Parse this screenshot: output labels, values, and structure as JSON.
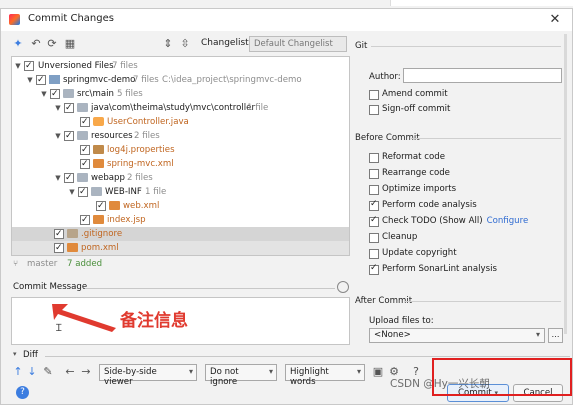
{
  "window": {
    "title": "Commit Changes",
    "close": "✕"
  },
  "toolbar": {
    "changelist_label": "Changelist:",
    "changelist_value": "Default Changelist"
  },
  "tree": [
    {
      "label": "Unversioned Files",
      "meta": "7 files"
    },
    {
      "label": "springmvc-demo",
      "meta": "7 files",
      "path": "C:\\idea_project\\springmvc-demo"
    },
    {
      "label": "src\\main",
      "meta": "5 files"
    },
    {
      "label": "java\\com\\theima\\study\\mvc\\controller",
      "meta": "1 file"
    },
    {
      "label": "UserController.java",
      "meta": ""
    },
    {
      "label": "resources",
      "meta": "2 files"
    },
    {
      "label": "log4j.properties",
      "meta": ""
    },
    {
      "label": "spring-mvc.xml",
      "meta": ""
    },
    {
      "label": "webapp",
      "meta": "2 files"
    },
    {
      "label": "WEB-INF",
      "meta": "1 file"
    },
    {
      "label": "web.xml",
      "meta": ""
    },
    {
      "label": "index.jsp",
      "meta": ""
    },
    {
      "label": ".gitignore",
      "meta": ""
    },
    {
      "label": "pom.xml",
      "meta": ""
    }
  ],
  "status": {
    "branch": "master",
    "added": "7 added"
  },
  "commit_message": {
    "title": "Commit Message",
    "annotation": "备注信息"
  },
  "diff": {
    "title": "Diff",
    "viewer": "Side-by-side viewer",
    "ignore": "Do not ignore",
    "highlight": "Highlight words"
  },
  "side": {
    "git_title": "Git",
    "author_label": "Author:",
    "author_value": "",
    "git_options": [
      {
        "label": "Amend commit",
        "checked": false
      },
      {
        "label": "Sign-off commit",
        "checked": false
      }
    ],
    "before_title": "Before Commit",
    "before_options": [
      {
        "label": "Reformat code",
        "checked": false
      },
      {
        "label": "Rearrange code",
        "checked": false
      },
      {
        "label": "Optimize imports",
        "checked": false
      },
      {
        "label": "Perform code analysis",
        "checked": true
      },
      {
        "label": "Check TODO (Show All)",
        "checked": true,
        "link": "Configure"
      },
      {
        "label": "Cleanup",
        "checked": false
      },
      {
        "label": "Update copyright",
        "checked": false
      },
      {
        "label": "Perform SonarLint analysis",
        "checked": true
      }
    ],
    "after_title": "After Commit",
    "upload_label": "Upload files to:",
    "upload_value": "<None>"
  },
  "buttons": {
    "commit": "Commit",
    "cancel": "Cancel"
  },
  "watermark": "CSDN @Hy一兴长朝",
  "colors": {
    "accent": "#3c7de0",
    "annotation_red": "#e03a2f",
    "highlight_box": "#e02020"
  }
}
